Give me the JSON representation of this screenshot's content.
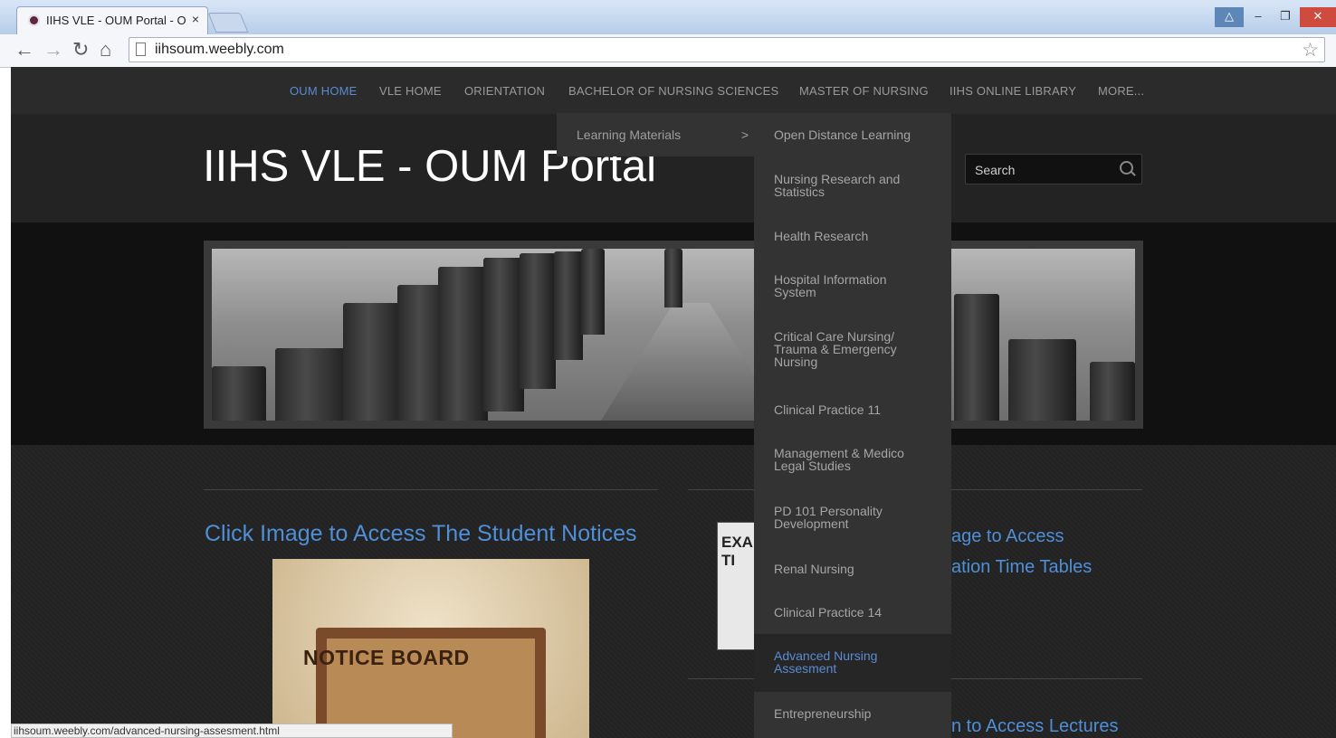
{
  "browser": {
    "tab_title": "IIHS VLE - OUM Portal - O",
    "tab_close": "×",
    "url": "iihsoum.weebly.com",
    "status_url": "iihsoum.weebly.com/advanced-nursing-assesment.html"
  },
  "nav": {
    "items": [
      "OUM HOME",
      "VLE HOME",
      "ORIENTATION",
      "BACHELOR OF NURSING SCIENCES",
      "MASTER OF NURSING",
      "IIHS ONLINE LIBRARY",
      "MORE..."
    ],
    "active_color": "#5b8bd0"
  },
  "header": {
    "site_title": "IIHS VLE - OUM Portal",
    "search_placeholder": "Search"
  },
  "dropdown": {
    "parent_label": "Learning Materials",
    "parent_arrow": ">",
    "items": [
      "Open Distance Learning",
      "Nursing Research and Statistics",
      "Health Research",
      "Hospital Information System",
      "Critical Care Nursing/ Trauma & Emergency Nursing",
      "Clinical Practice 11",
      "Management & Medico Legal Studies",
      "PD 101 Personality Development",
      "Renal Nursing",
      "Clinical Practice 14",
      "Advanced Nursing Assesment",
      "Entrepreneurship"
    ],
    "highlighted": "Advanced Nursing Assesment"
  },
  "content": {
    "left_title": "Click Image to Access The Student Notices",
    "notice_board_text": "NOTICE BOARD",
    "exam_image_text": "EXA TI",
    "right_title_line1": "age to Access",
    "right_title_line2": "ation Time Tables",
    "right_title_line3": "n to Access Lectures"
  }
}
